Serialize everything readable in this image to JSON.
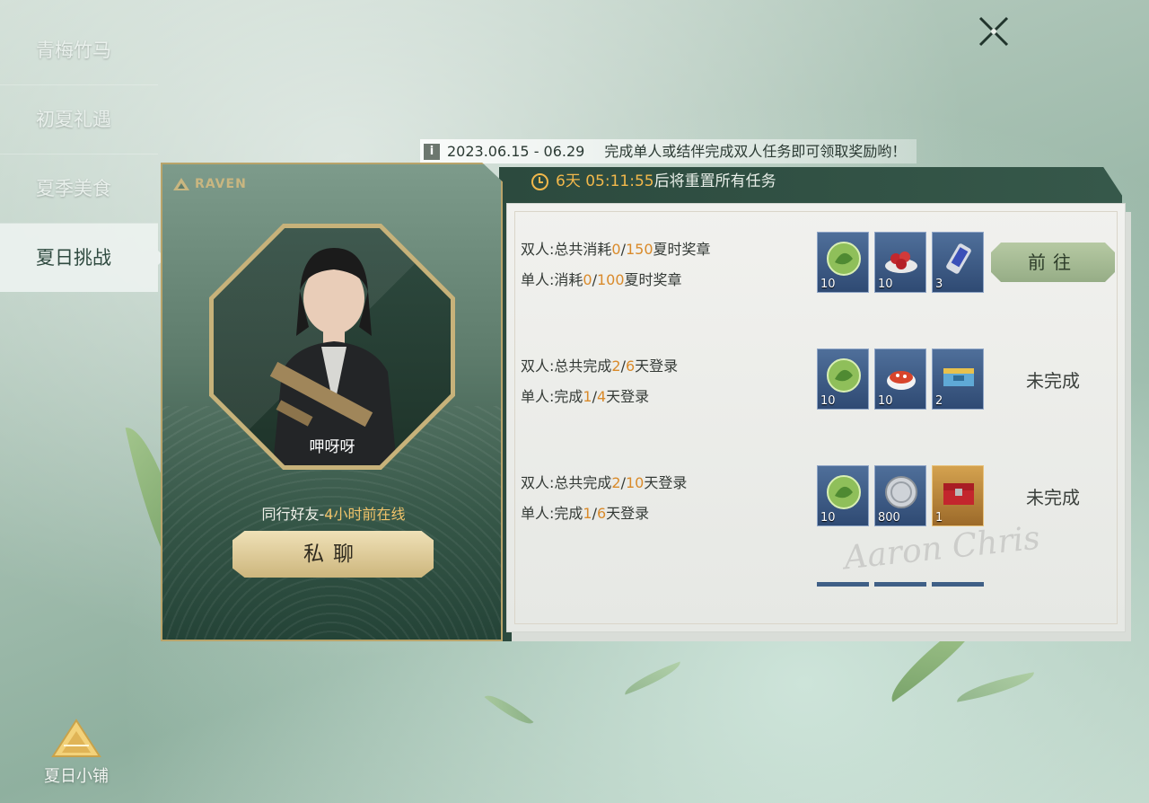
{
  "sidebar": {
    "items": [
      {
        "label": "青梅竹马"
      },
      {
        "label": "初夏礼遇"
      },
      {
        "label": "夏季美食"
      },
      {
        "label": "夏日挑战"
      }
    ],
    "active_index": 3,
    "shop_label": "夏日小铺"
  },
  "info": {
    "icon": "i",
    "date_range": "2023.06.15 - 06.29",
    "text": "完成单人或结伴完成双人任务即可领取奖励哟！"
  },
  "timer": {
    "days": "6天",
    "time": "05:11:55",
    "suffix": "后将重置所有任务"
  },
  "character": {
    "brand": "RAVEN",
    "name": "呷呀呀",
    "status_prefix": "同行好友-",
    "status_time": "4小时前在线",
    "chat_label": "私聊"
  },
  "tasks": [
    {
      "duo_prefix": "双人:总共消耗",
      "duo_done": "0",
      "duo_sep": "/",
      "duo_total": "150",
      "duo_suffix": "夏时奖章",
      "solo_prefix": "单人:消耗",
      "solo_done": "0",
      "solo_sep": "/",
      "solo_total": "100",
      "solo_suffix": "夏时奖章",
      "rewards": [
        {
          "icon": "green-medal-icon",
          "qty": "10",
          "style": "blue"
        },
        {
          "icon": "berries-plate-icon",
          "qty": "10",
          "style": "blue"
        },
        {
          "icon": "phone-device-icon",
          "qty": "3",
          "style": "blue"
        }
      ],
      "action": "前往",
      "completed_label": ""
    },
    {
      "duo_prefix": "双人:总共完成",
      "duo_done": "2",
      "duo_sep": "/",
      "duo_total": "6",
      "duo_suffix": "天登录",
      "solo_prefix": "单人:完成",
      "solo_done": "1",
      "solo_sep": "/",
      "solo_total": "4",
      "solo_suffix": "天登录",
      "rewards": [
        {
          "icon": "green-medal-icon",
          "qty": "10",
          "style": "blue"
        },
        {
          "icon": "food-bowl-icon",
          "qty": "10",
          "style": "blue"
        },
        {
          "icon": "supply-box-icon",
          "qty": "2",
          "style": "blue"
        }
      ],
      "action": "",
      "completed_label": "未完成"
    },
    {
      "duo_prefix": "双人:总共完成",
      "duo_done": "2",
      "duo_sep": "/",
      "duo_total": "10",
      "duo_suffix": "天登录",
      "solo_prefix": "单人:完成",
      "solo_done": "1",
      "solo_sep": "/",
      "solo_total": "6",
      "solo_suffix": "天登录",
      "rewards": [
        {
          "icon": "green-medal-icon",
          "qty": "10",
          "style": "blue"
        },
        {
          "icon": "silver-coin-icon",
          "qty": "800",
          "style": "blue"
        },
        {
          "icon": "red-crate-icon",
          "qty": "1",
          "style": "gold"
        }
      ],
      "action": "",
      "completed_label": "未完成"
    }
  ],
  "colors": {
    "accent_gold": "#c9b680",
    "highlight_orange": "#d98a2a",
    "timer_orange": "#f2b84b",
    "panel_green": "#36584a"
  }
}
